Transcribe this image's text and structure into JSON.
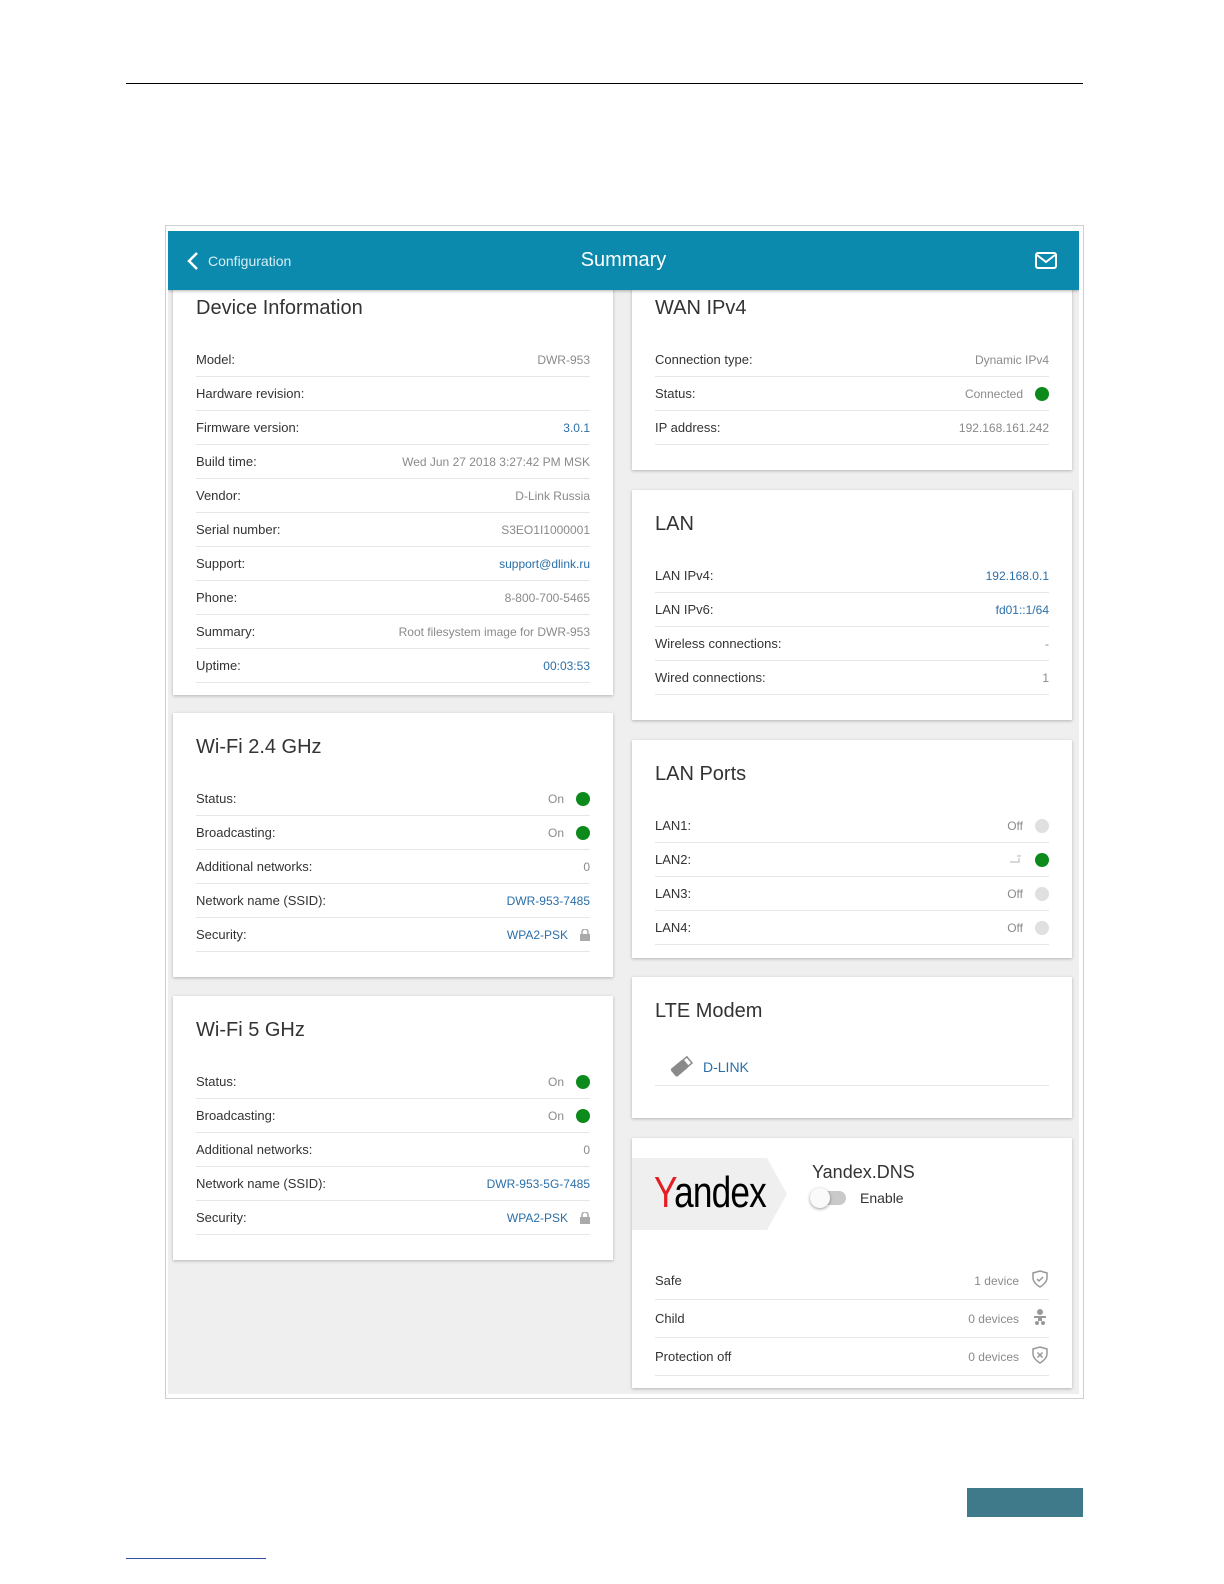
{
  "header": {
    "back_label": "Configuration",
    "title": "Summary",
    "mail_icon": "mail-icon"
  },
  "device_info": {
    "title": "Device Information",
    "rows": [
      {
        "label": "Model:",
        "value": "DWR-953"
      },
      {
        "label": "Hardware revision:",
        "value": ""
      },
      {
        "label": "Firmware version:",
        "value": "3.0.1",
        "link": true
      },
      {
        "label": "Build time:",
        "value": "Wed Jun 27 2018 3:27:42 PM MSK"
      },
      {
        "label": "Vendor:",
        "value": "D-Link Russia"
      },
      {
        "label": "Serial number:",
        "value": "S3EO1I1000001"
      },
      {
        "label": "Support:",
        "value": "support@dlink.ru",
        "link": true
      },
      {
        "label": "Phone:",
        "value": "8-800-700-5465"
      },
      {
        "label": "Summary:",
        "value": "Root filesystem image for DWR-953"
      },
      {
        "label": "Uptime:",
        "value": "00:03:53",
        "link": true
      }
    ]
  },
  "wifi24": {
    "title": "Wi-Fi 2.4 GHz",
    "rows": [
      {
        "label": "Status:",
        "value": "On",
        "dot": "on"
      },
      {
        "label": "Broadcasting:",
        "value": "On",
        "dot": "on"
      },
      {
        "label": "Additional networks:",
        "value": "0"
      },
      {
        "label": "Network name (SSID):",
        "value": "DWR-953-7485",
        "link": true
      },
      {
        "label": "Security:",
        "value": "WPA2-PSK",
        "link": true,
        "lock": true
      }
    ]
  },
  "wifi5": {
    "title": "Wi-Fi 5 GHz",
    "rows": [
      {
        "label": "Status:",
        "value": "On",
        "dot": "on"
      },
      {
        "label": "Broadcasting:",
        "value": "On",
        "dot": "on"
      },
      {
        "label": "Additional networks:",
        "value": "0"
      },
      {
        "label": "Network name (SSID):",
        "value": "DWR-953-5G-7485",
        "link": true
      },
      {
        "label": "Security:",
        "value": "WPA2-PSK",
        "link": true,
        "lock": true
      }
    ]
  },
  "wan": {
    "title": "WAN IPv4",
    "rows": [
      {
        "label": "Connection type:",
        "value": "Dynamic IPv4"
      },
      {
        "label": "Status:",
        "value": "Connected",
        "dot": "on"
      },
      {
        "label": "IP address:",
        "value": "192.168.161.242"
      }
    ]
  },
  "lan": {
    "title": "LAN",
    "rows": [
      {
        "label": "LAN IPv4:",
        "value": "192.168.0.1",
        "link": true
      },
      {
        "label": "LAN IPv6:",
        "value": "fd01::1/64",
        "link": true
      },
      {
        "label": "Wireless connections:",
        "value": "-"
      },
      {
        "label": "Wired connections:",
        "value": "1"
      }
    ]
  },
  "lan_ports": {
    "title": "LAN Ports",
    "rows": [
      {
        "label": "LAN1:",
        "value": "Off",
        "dot": "off"
      },
      {
        "label": "LAN2:",
        "value": "",
        "dot": "on",
        "plug": true
      },
      {
        "label": "LAN3:",
        "value": "Off",
        "dot": "off"
      },
      {
        "label": "LAN4:",
        "value": "Off",
        "dot": "off"
      }
    ]
  },
  "lte": {
    "title": "LTE Modem",
    "modem_name": "D-LINK"
  },
  "yandex": {
    "logo": "Yandex",
    "title": "Yandex.DNS",
    "toggle_label": "Enable",
    "toggle_on": false,
    "rows": [
      {
        "label": "Safe",
        "value": "1 device",
        "icon": "shield-check-icon"
      },
      {
        "label": "Child",
        "value": "0 devices",
        "icon": "child-icon"
      },
      {
        "label": "Protection off",
        "value": "0 devices",
        "icon": "shield-x-icon"
      }
    ]
  },
  "colors": {
    "accent": "#0b8aad",
    "link": "#2a6fa8",
    "on": "#0c8a1c",
    "off": "#e0e0e0"
  }
}
